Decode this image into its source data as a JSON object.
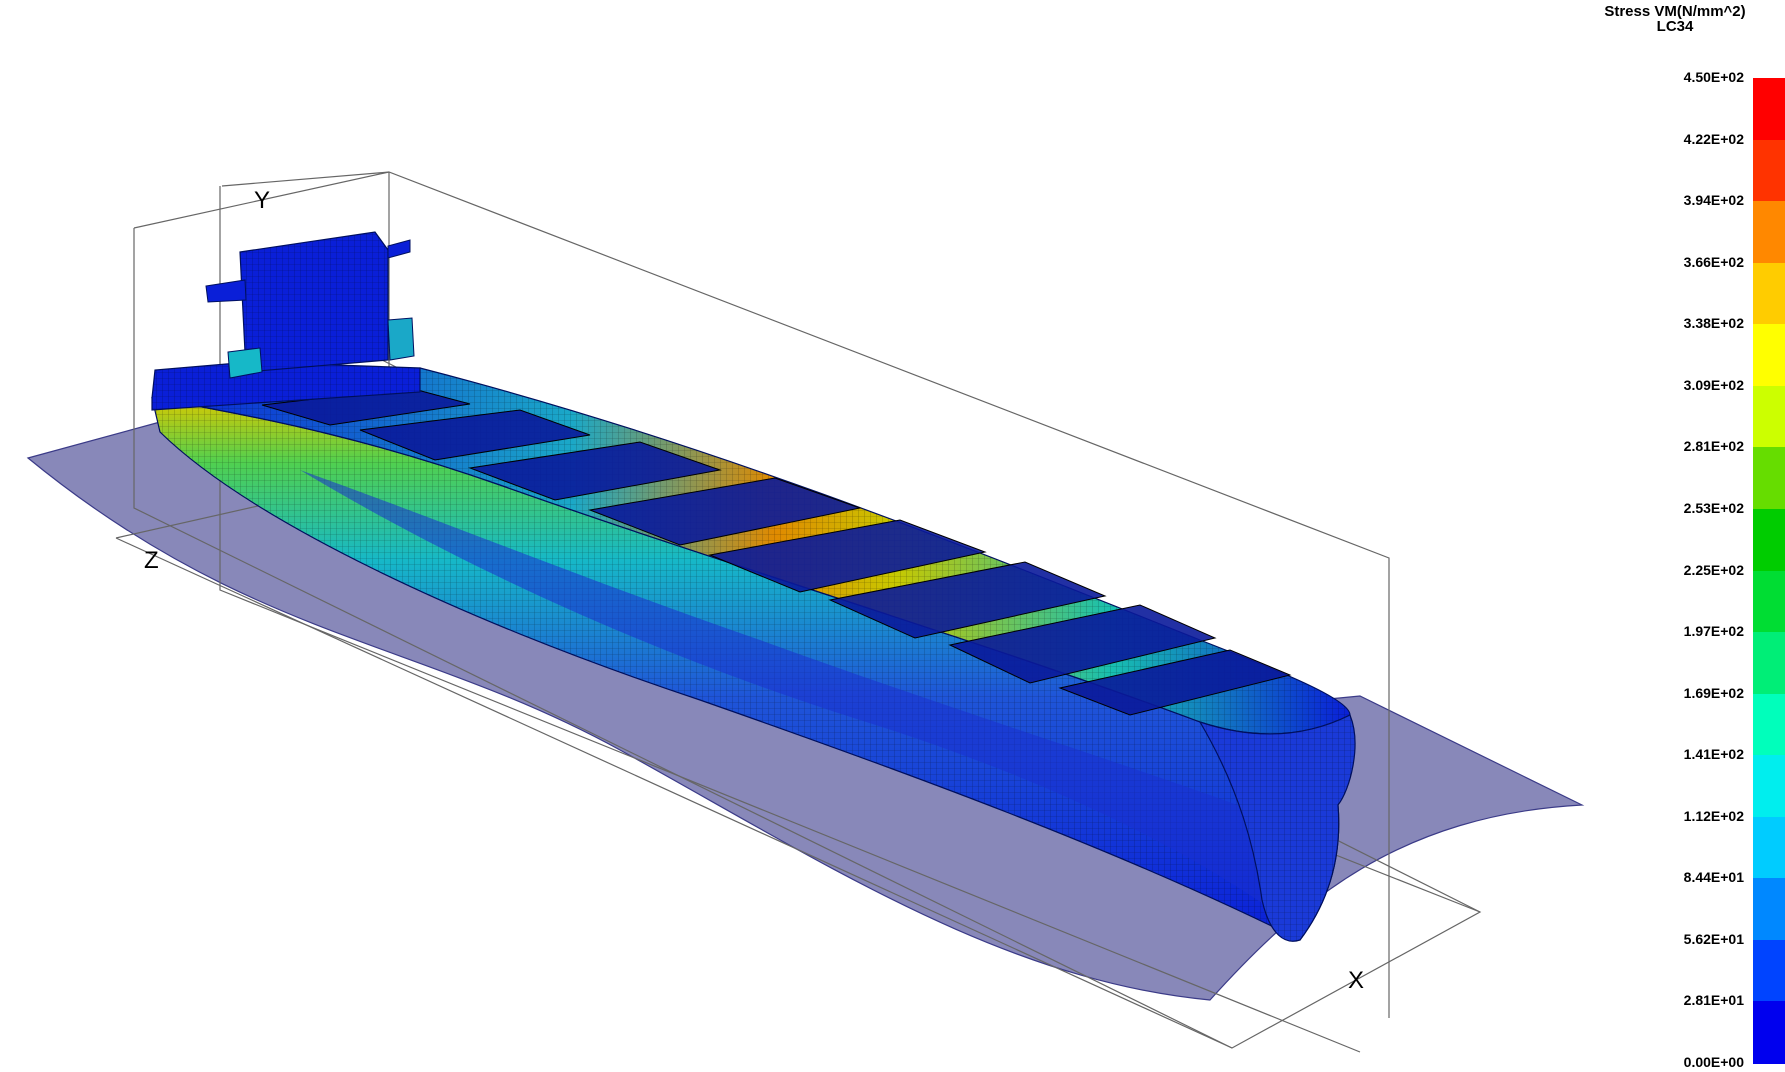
{
  "legend": {
    "title": "Stress VM(N/mm^2)",
    "subtitle": "LC34",
    "ticks": [
      "4.50E+02",
      "4.22E+02",
      "3.94E+02",
      "3.66E+02",
      "3.38E+02",
      "3.09E+02",
      "2.81E+02",
      "2.53E+02",
      "2.25E+02",
      "1.97E+02",
      "1.69E+02",
      "1.41E+02",
      "1.12E+02",
      "8.44E+01",
      "5.62E+01",
      "2.81E+01",
      "0.00E+00"
    ],
    "colors": [
      "#ff0000",
      "#ff3300",
      "#ff8800",
      "#ffcc00",
      "#ffff00",
      "#ccff00",
      "#66dd00",
      "#00cc00",
      "#00dd33",
      "#00ee77",
      "#00ffbb",
      "#00eeee",
      "#00ccff",
      "#0088ff",
      "#0044ff",
      "#0000ee"
    ]
  },
  "axes": {
    "x": "X",
    "y": "Y",
    "z": "Z"
  },
  "colors": {
    "water_plane": "#6a6aa8",
    "hull_low": "#0a1fd8",
    "wire": "#555555"
  }
}
